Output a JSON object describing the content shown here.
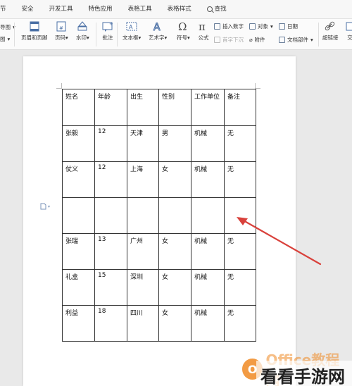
{
  "tabs": [
    "节",
    "安全",
    "开发工具",
    "特色应用",
    "表格工具",
    "表格样式",
    "查找"
  ],
  "toolbar": {
    "left_partial_1": "导图",
    "left_partial_2": "图",
    "header_footer": "页眉和页脚",
    "page_number": "页码",
    "watermark": "水印",
    "comment": "批注",
    "textbox": "文本框",
    "art_text": "艺术字",
    "symbol": "符号",
    "formula": "公式",
    "insert_number": "插入数字",
    "object": "对象",
    "date": "日期",
    "first_letter_sink": "首字下沉",
    "attachment": "附件",
    "doc_parts": "文档部件",
    "hyperlink": "超链接",
    "cross_ref": "交"
  },
  "table": {
    "header": [
      "姓名",
      "年龄",
      "出生",
      "性别",
      "工作单位",
      "备注"
    ],
    "rows": [
      [
        "张毅",
        "12",
        "天津",
        "男",
        "机械",
        "无"
      ],
      [
        "仗义",
        "12",
        "上海",
        "女",
        "机械",
        "无"
      ],
      [
        "",
        "",
        "",
        "",
        "",
        ""
      ],
      [
        "张瑞",
        "13",
        "广州",
        "女",
        "机械",
        "无"
      ],
      [
        "礼盒",
        "15",
        "深圳",
        "女",
        "机械",
        "无"
      ],
      [
        "利益",
        "18",
        "四川",
        "女",
        "机械",
        "无"
      ]
    ]
  },
  "watermarks": {
    "office_logo": "O",
    "office_text": "Office教程网",
    "site_text": "看看手游网"
  },
  "colors": {
    "arrow": "#d9413b",
    "office_orange": "#f08a24"
  }
}
